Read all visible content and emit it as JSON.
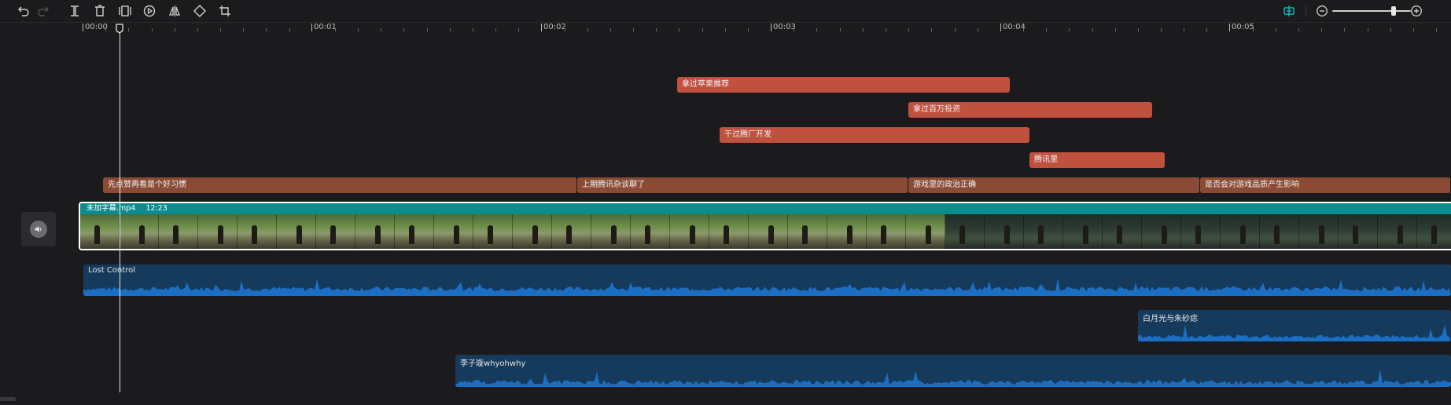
{
  "toolbar": {
    "left_icons": [
      "undo-icon",
      "redo-icon",
      "split-icon",
      "delete-icon",
      "freeze-frame-icon",
      "play-reverse-icon",
      "mirror-icon",
      "rotate-icon",
      "crop-icon"
    ],
    "right_icons": [
      "snap-icon",
      "zoom-out-icon",
      "zoom-in-icon"
    ],
    "accent_color": "#19b5b5",
    "zoom_level": 0.78
  },
  "ruler": {
    "labels": [
      "00:00",
      "00:01",
      "00:02",
      "00:03",
      "00:04",
      "00:05"
    ]
  },
  "text_track_rows": [
    [
      {
        "label": "拿过苹果推荐"
      }
    ],
    [
      {
        "label": "拿过百万投资"
      }
    ],
    [
      {
        "label": "干过腾厂开发"
      }
    ],
    [
      {
        "label": "腾讯里"
      }
    ]
  ],
  "subtitle_track": [
    {
      "label": "先点赞再看是个好习惯"
    },
    {
      "label": "上期腾讯杂谈聊了"
    },
    {
      "label": "游戏里的政治正确"
    },
    {
      "label": "是否会对游戏品质产生影响"
    }
  ],
  "video_clip": {
    "name": "未加字幕.mp4",
    "duration": "12:23"
  },
  "audio_clips": [
    {
      "name": "Lost Control"
    },
    {
      "name": "白月光与朱砂痣"
    },
    {
      "name": "李子璇whyohwhy"
    }
  ],
  "mute_button": {
    "icon": "speaker-icon"
  }
}
